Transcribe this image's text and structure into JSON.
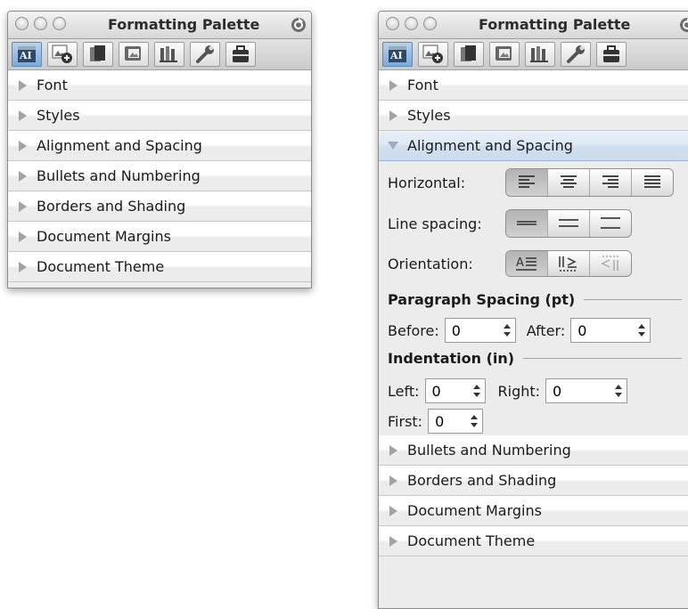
{
  "left_palette": {
    "title": "Formatting Palette",
    "toolbar_icons": [
      "formatting-icon",
      "add-objects-icon",
      "citations-icon",
      "object-palette-icon",
      "scrapbook-icon",
      "reference-tools-icon",
      "compatibility-report-icon"
    ],
    "sections": [
      "Font",
      "Styles",
      "Alignment and Spacing",
      "Bullets and Numbering",
      "Borders and Shading",
      "Document Margins",
      "Document Theme"
    ]
  },
  "right_palette": {
    "title": "Formatting Palette",
    "toolbar_icons": [
      "formatting-icon",
      "add-objects-icon",
      "citations-icon",
      "object-palette-icon",
      "scrapbook-icon",
      "reference-tools-icon",
      "compatibility-report-icon"
    ],
    "sections_before": [
      "Font",
      "Styles"
    ],
    "open_section": "Alignment and Spacing",
    "alignment": {
      "horizontal_label": "Horizontal:",
      "horizontal_options": [
        "align-left-icon",
        "align-center-icon",
        "align-right-icon",
        "justify-icon"
      ],
      "horizontal_selected": 0,
      "line_spacing_label": "Line spacing:",
      "line_spacing_options": [
        "single-spacing-icon",
        "one-half-spacing-icon",
        "double-spacing-icon"
      ],
      "line_spacing_selected": 0,
      "orientation_label": "Orientation:",
      "orientation_options": [
        "horizontal-text-icon",
        "vertical-text-down-icon",
        "vertical-text-up-icon"
      ],
      "orientation_selected": 0,
      "paragraph_spacing": {
        "heading": "Paragraph Spacing (pt)",
        "before_label": "Before:",
        "before_value": "0",
        "after_label": "After:",
        "after_value": "0"
      },
      "indentation": {
        "heading": "Indentation (in)",
        "left_label": "Left:",
        "left_value": "0",
        "right_label": "Right:",
        "right_value": "0",
        "first_label": "First:",
        "first_value": "0"
      }
    },
    "sections_after": [
      "Bullets and Numbering",
      "Borders and Shading",
      "Document Margins",
      "Document Theme"
    ]
  }
}
